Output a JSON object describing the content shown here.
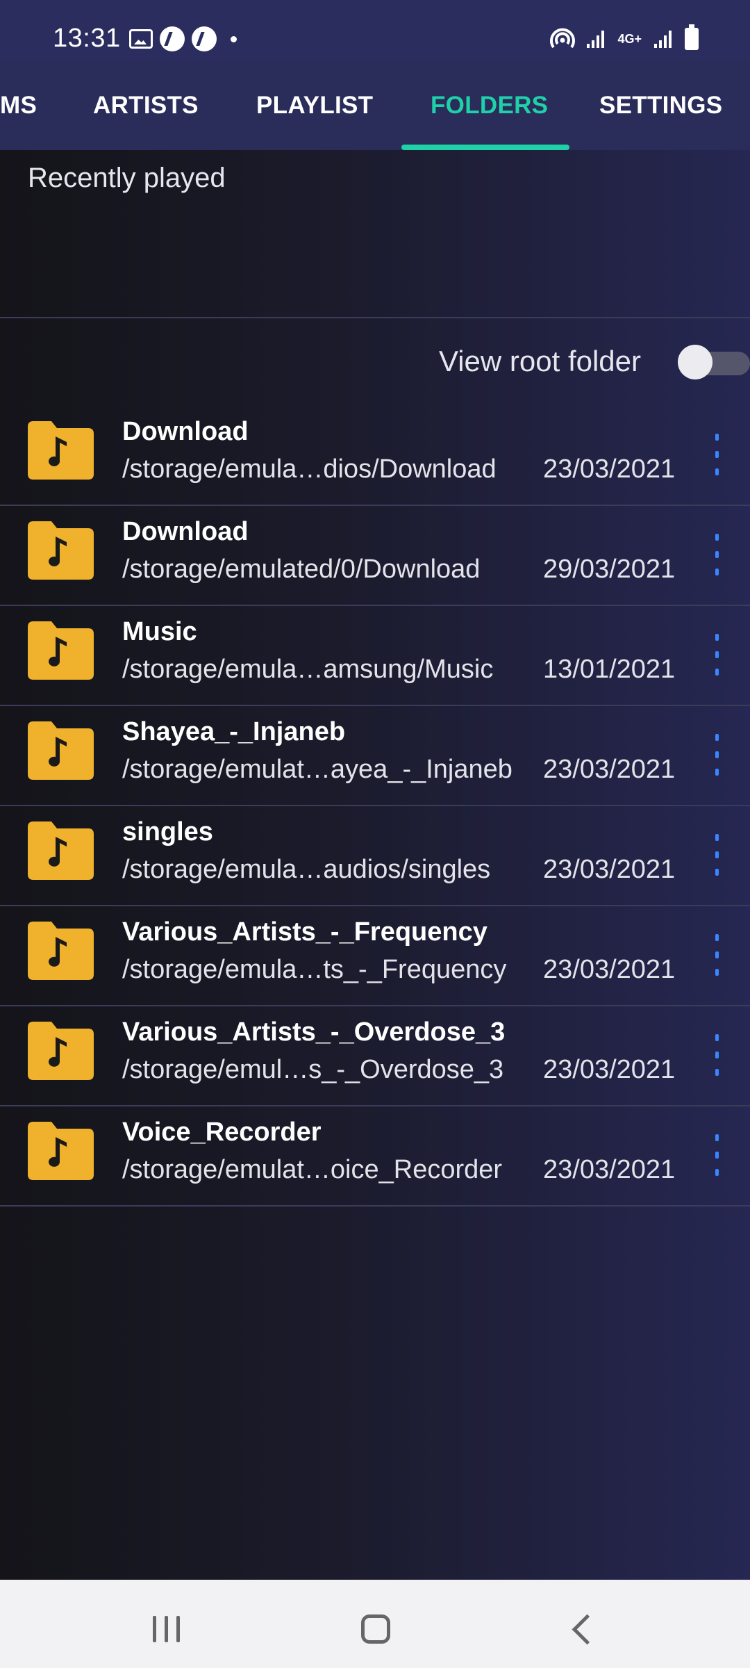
{
  "status": {
    "time": "13:31",
    "notification_icons": [
      "image-icon",
      "cleaner-icon",
      "cleaner-icon",
      "dot-icon"
    ],
    "right_icons": [
      "hotspot-icon",
      "signal-icon",
      "4g-icon",
      "signal-icon",
      "battery-icon"
    ],
    "network": "4G+"
  },
  "tabs": [
    {
      "label": "MS",
      "active": false
    },
    {
      "label": "ARTISTS",
      "active": false
    },
    {
      "label": "PLAYLIST",
      "active": false
    },
    {
      "label": "FOLDERS",
      "active": true
    },
    {
      "label": "SETTINGS",
      "active": false
    }
  ],
  "recent": {
    "title": "Recently played"
  },
  "root_toggle": {
    "label": "View root folder",
    "on": false
  },
  "folders": [
    {
      "name": "Download",
      "path": "/storage/emula…dios/Download",
      "date": "23/03/2021"
    },
    {
      "name": "Download",
      "path": "/storage/emulated/0/Download",
      "date": "29/03/2021"
    },
    {
      "name": "Music",
      "path": "/storage/emula…amsung/Music",
      "date": "13/01/2021"
    },
    {
      "name": "Shayea_-_Injaneb",
      "path": "/storage/emulat…ayea_-_Injaneb",
      "date": "23/03/2021"
    },
    {
      "name": "singles",
      "path": "/storage/emula…audios/singles",
      "date": "23/03/2021"
    },
    {
      "name": "Various_Artists_-_Frequency",
      "path": "/storage/emula…ts_-_Frequency",
      "date": "23/03/2021"
    },
    {
      "name": "Various_Artists_-_Overdose_3",
      "path": "/storage/emul…s_-_Overdose_3",
      "date": "23/03/2021"
    },
    {
      "name": "Voice_Recorder",
      "path": "/storage/emulat…oice_Recorder",
      "date": "23/03/2021"
    }
  ],
  "colors": {
    "accent": "#1fd1a9",
    "folder_icon": "#f0b12c",
    "more_dots": "#3a86ff"
  }
}
